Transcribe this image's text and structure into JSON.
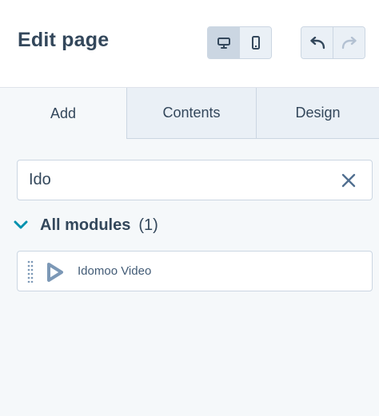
{
  "header": {
    "title": "Edit page",
    "view_buttons": [
      {
        "name": "desktop",
        "icon": "desktop-icon",
        "active": true
      },
      {
        "name": "mobile",
        "icon": "mobile-icon",
        "active": false
      }
    ],
    "history_buttons": [
      {
        "name": "undo",
        "icon": "undo-icon"
      },
      {
        "name": "redo",
        "icon": "redo-icon",
        "disabled": true
      }
    ]
  },
  "tabs": [
    {
      "label": "Add",
      "active": true
    },
    {
      "label": "Contents",
      "active": false
    },
    {
      "label": "Design",
      "active": false
    }
  ],
  "search": {
    "value": "Ido",
    "clear_icon": "close-icon"
  },
  "section": {
    "label": "All modules",
    "count": "(1)",
    "expanded": true
  },
  "modules": [
    {
      "label": "Idomoo Video",
      "icon": "idomoo-play-icon"
    }
  ],
  "colors": {
    "text": "#33475b",
    "border": "#cbd6e2",
    "panel_bg": "#f5f8fa",
    "tab_bg": "#eaf0f6",
    "accent": "#0091ae",
    "icon_muted": "#b3c1d2"
  }
}
